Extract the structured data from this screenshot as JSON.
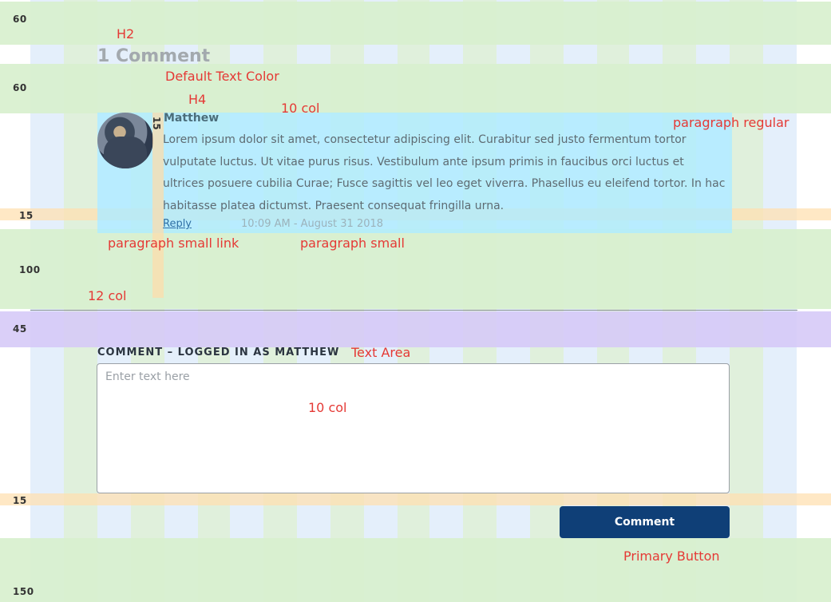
{
  "spacing_labels": {
    "top": "60",
    "after_h2": "60",
    "after_comment": "15",
    "after_meta": "100",
    "after_divider": "45",
    "after_textarea": "15",
    "bottom": "150",
    "avatar_gutter": "15"
  },
  "annotations": {
    "h2": "H2",
    "default_text_color": "Default Text Color",
    "h4": "H4",
    "ten_col_top": "10 col",
    "paragraph_regular": "paragraph regular",
    "paragraph_small_link": "paragraph small link",
    "paragraph_small": "paragraph small",
    "twelve_col": "12 col",
    "text_area": "Text Area",
    "ten_col_textarea": "10 col",
    "primary_button": "Primary Button"
  },
  "comments_section": {
    "heading": "1 Comment",
    "comment": {
      "author": "Matthew",
      "body": "Lorem ipsum dolor sit amet, consectetur adipiscing elit. Curabitur sed justo fermentum tortor vulputate luctus. Ut vitae purus risus. Vestibulum ante ipsum primis in faucibus orci luctus et ultrices posuere cubilia Curae; Fusce sagittis vel leo eget viverra. Phasellus eu eleifend tortor. In hac habitasse platea dictumst. Praesent consequat fringilla urna.",
      "reply_label": "Reply",
      "timestamp": "10:09 AM - August 31 2018"
    }
  },
  "form": {
    "label": "COMMENT – LOGGED IN AS MATTHEW",
    "placeholder": "Enter text here",
    "value": "",
    "submit_label": "Comment"
  },
  "colors": {
    "primary_button": "#0f3f77",
    "annotation": "#e53935",
    "heading": "#a3a9ae",
    "link": "#2f6fa3"
  }
}
